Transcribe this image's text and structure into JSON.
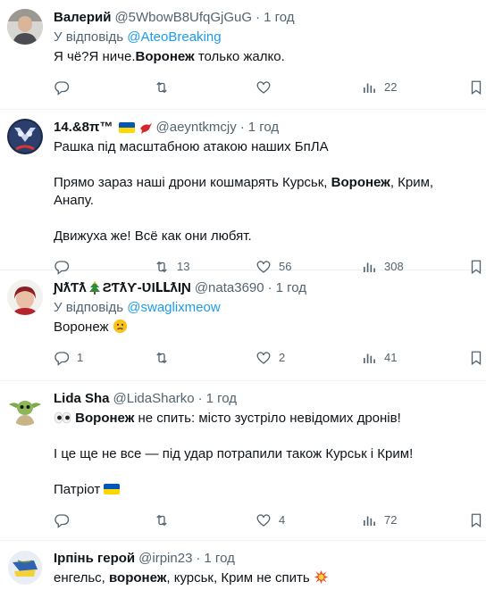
{
  "colors": {
    "link": "#1d9bf0",
    "secondary": "#536471",
    "text": "#0f1419",
    "divider": "#eff3f4"
  },
  "tweets": [
    {
      "name": "Валерий",
      "handle": "@5WbowB8UfqGjGuG",
      "dot": "·",
      "time": "1 год",
      "reply_prefix": "У відповідь",
      "reply_handle": "@AteoBreaking",
      "text_a": "Я чё?Я ниче.",
      "text_bold": "Воронеж",
      "text_b": " только жалко.",
      "replies": "",
      "retweets": "",
      "likes": "",
      "views": "22"
    },
    {
      "name": "14.&8π™",
      "handle": "@aeyntkmcjy",
      "dot": "·",
      "time": "1 год",
      "line1": "Рашка під масштабною атакою наших БпЛА",
      "line2_a": "Прямо зараз наші дрони кошмарять Курськ, ",
      "line2_bold": "Воронеж",
      "line2_b": ", Крим, Анапу.",
      "line3": "Движуха же! Всё как они любят.",
      "replies": "",
      "retweets": "13",
      "likes": "56",
      "views": "308"
    },
    {
      "name_a": "ƝƛƬƛ",
      "name_b": "ƧƬƛƳ-ƲƖԼԼƛƖƝ",
      "handle": "@nata3690",
      "dot": "·",
      "time": "1 год",
      "reply_prefix": "У відповідь",
      "reply_handle": "@swaglixmeow",
      "text": "Воронеж ",
      "replies": "1",
      "retweets": "",
      "likes": "2",
      "views": "41"
    },
    {
      "name": "Lida Sha",
      "handle": "@LidaSharko",
      "dot": "·",
      "time": "1 год",
      "line1_bold": "Воронеж",
      "line1_b": " не спить: місто зустріло невідомих дронів!",
      "line2": "І це ще не все — під удар потрапили також Курськ і Крим!",
      "line3": "Патріот ",
      "replies": "",
      "retweets": "",
      "likes": "4",
      "views": "72"
    },
    {
      "name": "Ірпінь герой",
      "handle": "@irpin23",
      "dot": "·",
      "time": "1 год",
      "text_a": "енгельс, ",
      "text_bold": "воронеж",
      "text_b": ", курськ, Крим не спить "
    }
  ]
}
